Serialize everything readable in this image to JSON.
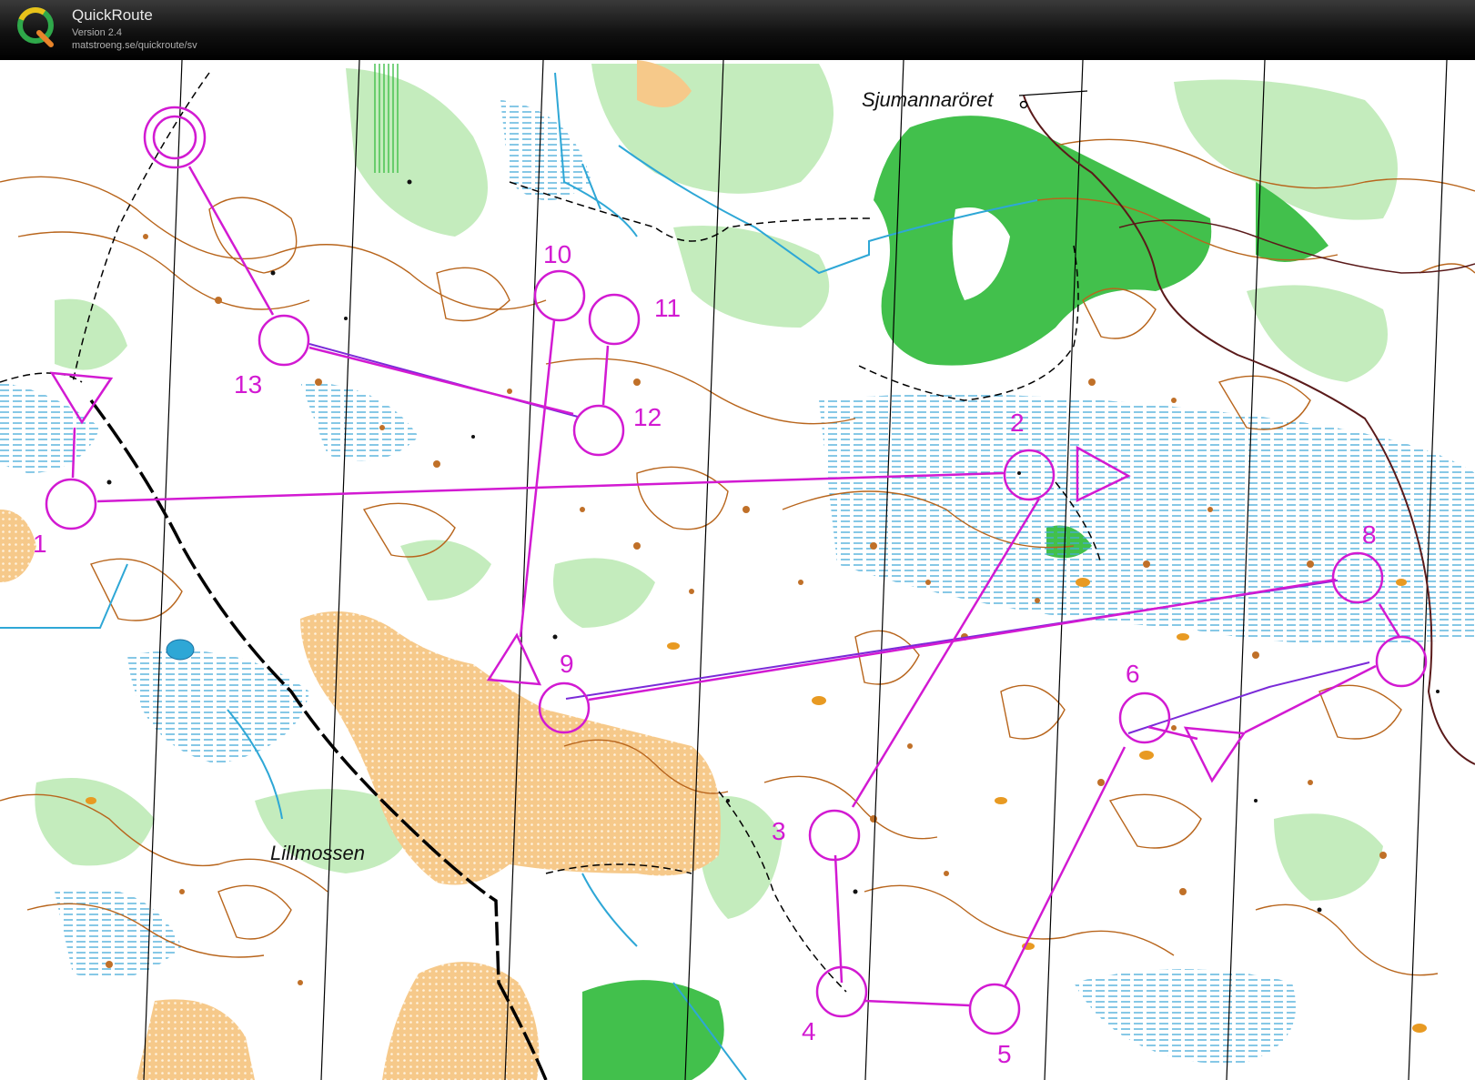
{
  "app": {
    "name": "QuickRoute",
    "version": "Version 2.4",
    "url": "matstroeng.se/quickroute/sv",
    "logo_letter": "Q"
  },
  "map": {
    "place_names": {
      "sjumannaroret": "Sjumannaröret",
      "lillmossen": "Lillmossen"
    },
    "colors": {
      "course": "#d21ad2",
      "route": "#7a2ad8",
      "forest_green": "#3fbf4a",
      "light_green": "#b9e8b0",
      "open_land": "#f2c97a",
      "water": "#2ea7d6",
      "contour": "#b8651c",
      "paper": "#ffffff"
    },
    "controls": [
      {
        "label": "1"
      },
      {
        "label": "2"
      },
      {
        "label": "3"
      },
      {
        "label": "4"
      },
      {
        "label": "5"
      },
      {
        "label": "6"
      },
      {
        "label": "8"
      },
      {
        "label": "9"
      },
      {
        "label": "10"
      },
      {
        "label": "11"
      },
      {
        "label": "12"
      },
      {
        "label": "13"
      }
    ]
  }
}
